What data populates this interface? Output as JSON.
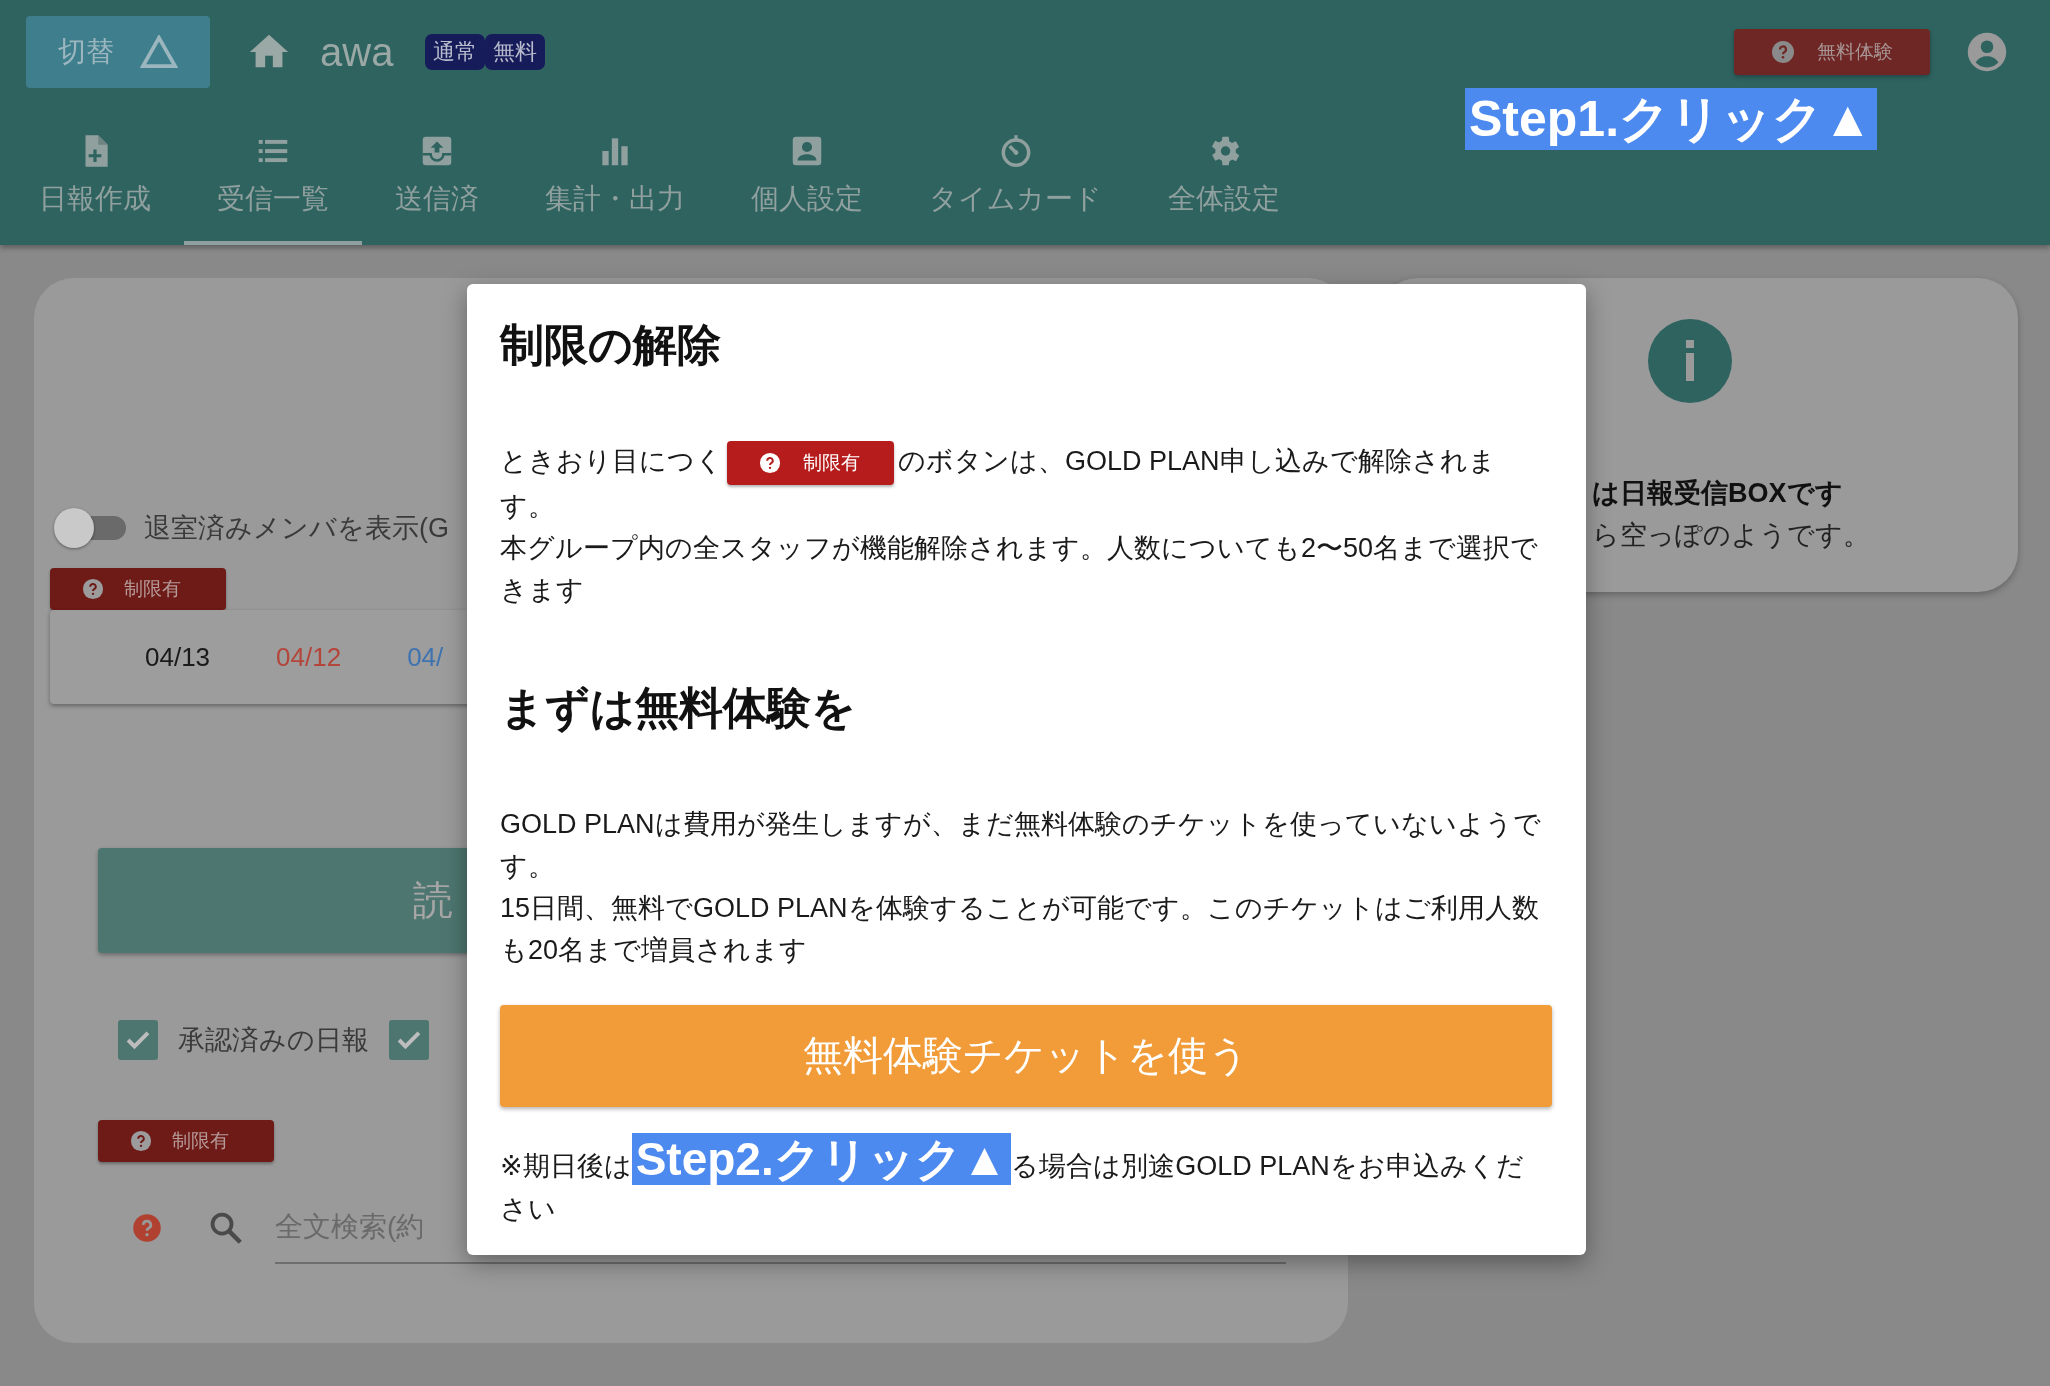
{
  "header": {
    "switch_button": {
      "label": "切替"
    },
    "app_name": "awa",
    "plan_badges": [
      "通常",
      "無料"
    ],
    "trial_button": {
      "label": "無料体験"
    },
    "nav_tabs": [
      {
        "label": "日報作成",
        "selected": false
      },
      {
        "label": "受信一覧",
        "selected": true
      },
      {
        "label": "送信済",
        "selected": false
      },
      {
        "label": "集計・出力",
        "selected": false
      },
      {
        "label": "個人設定",
        "selected": false
      },
      {
        "label": "タイムカード",
        "selected": false
      },
      {
        "label": "全体設定",
        "selected": false
      }
    ]
  },
  "step1_annotation": "Step1.クリック▲",
  "left_panel": {
    "toggle": {
      "label": "退室済みメンバを表示(G",
      "on": false
    },
    "limit_badge_top": "制限有",
    "dates": [
      {
        "text": "04/13",
        "color": "#1a1a1a"
      },
      {
        "text": "04/12",
        "color": "#b4453a"
      },
      {
        "text": "04/",
        "color": "#3f73b0"
      }
    ],
    "read_button": "読",
    "checkboxes": [
      {
        "label": "承認済みの日報",
        "checked": true
      },
      {
        "checked": true
      }
    ],
    "limit_badge_bottom": "制限有",
    "search": {
      "placeholder": "全文検索(約"
    }
  },
  "right_panel": {
    "title": "は日報受信BOXです",
    "message": "ら空っぽのようです。"
  },
  "modal": {
    "title": "制限の解除",
    "intro": {
      "before": "ときおり目につく",
      "badge": "制限有",
      "after": "のボタンは、GOLD PLAN申し込みで解除されま",
      "after_continued": "す。"
    },
    "intro_note": "本グループ内の全スタッフが機能解除されます。人数についても2〜50名まで選択できます",
    "subtitle": "まずは無料体験を",
    "trial_lines": [
      "GOLD PLANは費用が発生しますが、まだ無料体験のチケットを使っていないようです。",
      "15日間、無料でGOLD PLANを体験することが可能です。このチケットはご利用人数も20名まで増員されます"
    ],
    "trial_button": "無料体験チケットを使う",
    "footnote": {
      "before": "※期日後は",
      "annotation": "Step2.クリック▲",
      "after": "る場合は別途GOLD PLANをお申込みくだ",
      "after_continued": "さい"
    }
  }
}
